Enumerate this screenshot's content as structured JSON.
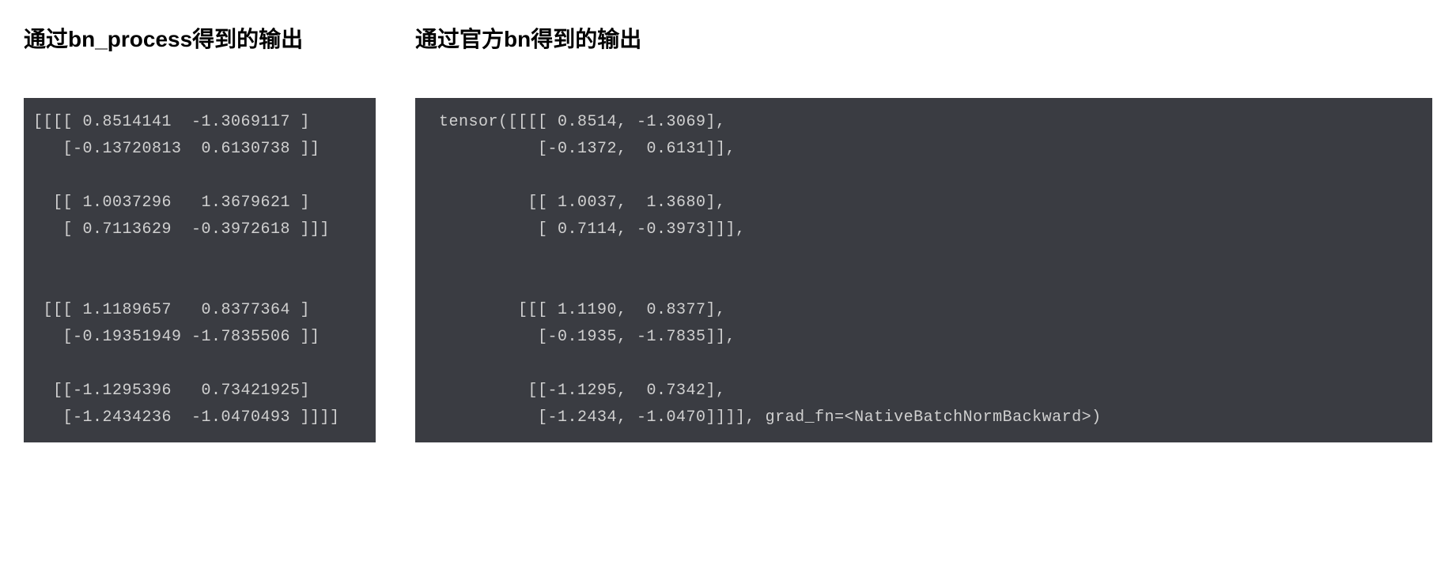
{
  "left": {
    "heading": "通过bn_process得到的输出",
    "code": "[[[[ 0.8514141  -1.3069117 ]\n   [-0.13720813  0.6130738 ]]\n\n  [[ 1.0037296   1.3679621 ]\n   [ 0.7113629  -0.3972618 ]]]\n\n\n [[[ 1.1189657   0.8377364 ]\n   [-0.19351949 -1.7835506 ]]\n\n  [[-1.1295396   0.73421925]\n   [-1.2434236  -1.0470493 ]]]]"
  },
  "right": {
    "heading": "通过官方bn得到的输出",
    "code": "tensor([[[[ 0.8514, -1.3069],\n          [-0.1372,  0.6131]],\n\n         [[ 1.0037,  1.3680],\n          [ 0.7114, -0.3973]]],\n\n\n        [[[ 1.1190,  0.8377],\n          [-0.1935, -1.7835]],\n\n         [[-1.1295,  0.7342],\n          [-1.2434, -1.0470]]]], grad_fn=<NativeBatchNormBackward>)"
  }
}
